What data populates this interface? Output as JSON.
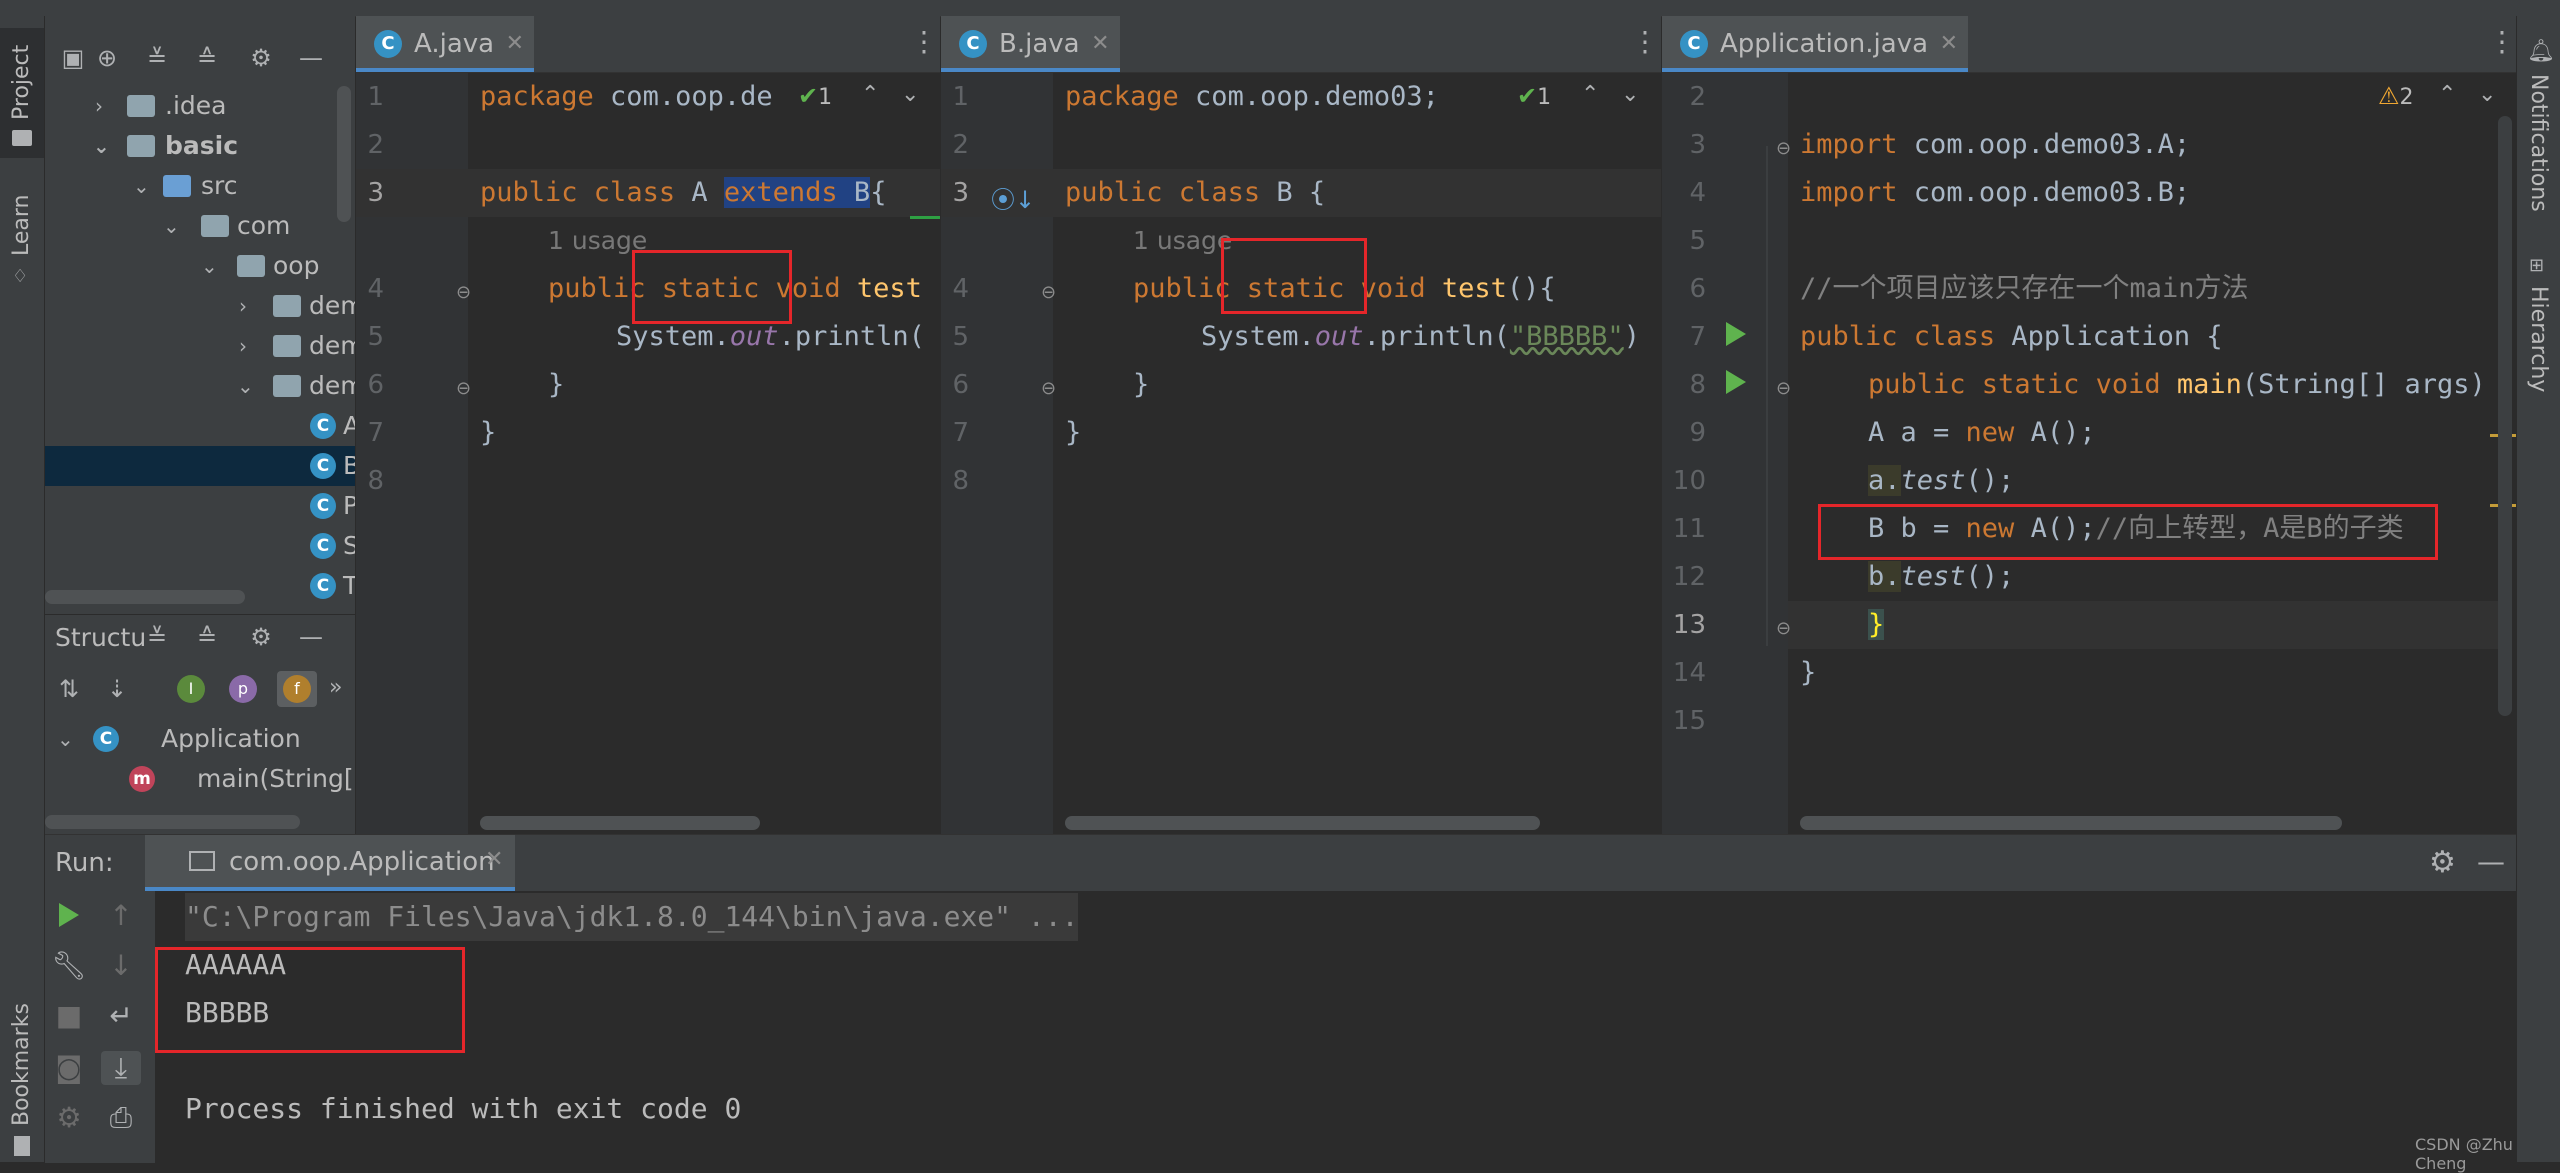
{
  "colors": {
    "keyword": "#cc7832",
    "function": "#ffc66d",
    "string": "#6a8759",
    "comment": "#808080",
    "field": "#9876aa",
    "accent": "#4a88c7",
    "highlight_box": "#e5262a",
    "run_green": "#5fb34e"
  },
  "left_stripe": {
    "project": "Project",
    "learn": "Learn",
    "bookmarks": "Bookmarks"
  },
  "right_stripe": {
    "notifications": "Notifications",
    "hierarchy": "Hierarchy"
  },
  "project_tree": [
    {
      "label": ".idea",
      "type": "folder"
    },
    {
      "label": "basic",
      "type": "folder"
    },
    {
      "label": "src",
      "type": "folder"
    },
    {
      "label": "com",
      "type": "folder"
    },
    {
      "label": "oop",
      "type": "folder"
    },
    {
      "label": "dem",
      "type": "folder"
    },
    {
      "label": "dem",
      "type": "folder"
    },
    {
      "label": "dem",
      "type": "folder"
    },
    {
      "label": "A",
      "type": "class"
    },
    {
      "label": "B",
      "type": "class"
    },
    {
      "label": "P",
      "type": "class"
    },
    {
      "label": "S",
      "type": "class"
    },
    {
      "label": "T",
      "type": "class"
    }
  ],
  "structure": {
    "title": "Structu",
    "root": "Application",
    "child": "main(String[])",
    "filter_labels": [
      "I",
      "p",
      "f"
    ]
  },
  "editors": [
    {
      "tab": "A.java",
      "lines": [
        "1",
        "2",
        "3",
        "4",
        "5",
        "6",
        "7",
        "8"
      ],
      "check_count": "1",
      "code": {
        "package": "package",
        "pkgname": " com.oop.de",
        "public": "public",
        "class": " class",
        "name": " A ",
        "extends": "extends",
        "parent": " B",
        "brace": "{",
        "usage": "1 usage",
        "m_public": "public",
        "m_static": " static",
        "m_void": " void",
        "m_name": " test",
        "sys": "System.",
        "out": "out",
        "println": ".println(",
        "close1": "}",
        "close2": "}"
      }
    },
    {
      "tab": "B.java",
      "lines": [
        "1",
        "2",
        "3",
        "4",
        "5",
        "6",
        "7",
        "8"
      ],
      "check_count": "1",
      "code": {
        "package": "package",
        "pkgname": " com.oop.demo03;",
        "public": "public",
        "class": " class",
        "name": " B ",
        "brace": "{",
        "usage": "1 usage",
        "m_public": "public",
        "m_static": " static",
        "m_void": " void",
        "m_name": " test",
        "m_paren": "(){",
        "sys": "System.",
        "out": "out",
        "println": ".println(",
        "str": "\"BBBBB\"",
        "endp": ")",
        "close1": "}",
        "close2": "}"
      }
    },
    {
      "tab": "Application.java",
      "lines": [
        "2",
        "3",
        "4",
        "5",
        "6",
        "7",
        "8",
        "9",
        "10",
        "11",
        "12",
        "13",
        "14",
        "15"
      ],
      "warn_count": "2",
      "code": {
        "import": "import",
        "imp1": " com.oop.demo03.A;",
        "imp2": " com.oop.demo03.B;",
        "comment": "//一个项目应该只存在一个main方法",
        "public": "public",
        "class": " class",
        "name": " Application {",
        "m_public": "public",
        "m_static": " static",
        "m_void": " void",
        "m_name": " main",
        "m_args": "(String[] args)",
        "l9a": "A a = ",
        "new": "new",
        "l9b": " A();",
        "l10a": "a.",
        "test": "test",
        "l10b": "();",
        "l11a": "B b = ",
        "l11b": " A();",
        "l11c": "//向上转型，A是B的子类",
        "l12a": "b.",
        "l12b": "();",
        "close1": "}",
        "close2": "}"
      }
    }
  ],
  "run": {
    "label": "Run:",
    "tab": "com.oop.Application",
    "output": [
      "\"C:\\Program Files\\Java\\jdk1.8.0_144\\bin\\java.exe\" ...",
      "AAAAAA",
      "BBBBB",
      "",
      "Process finished with exit code 0"
    ]
  },
  "watermark": "CSDN @Zhu Cheng"
}
